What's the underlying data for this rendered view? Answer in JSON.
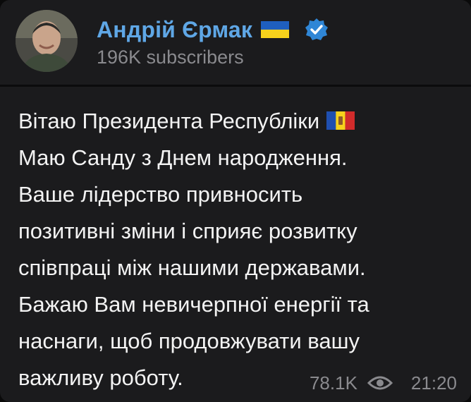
{
  "channel": {
    "name": "Андрій Єрмак",
    "subscribers": "196K subscribers",
    "flag_icon": "ukraine-flag-icon",
    "verified_icon": "verified-badge-icon"
  },
  "post": {
    "lines": [
      "Вітаю Президента Республіки",
      "Маю Санду з Днем народження.",
      "Ваше лідерство привносить",
      "позитивні зміни і сприяє розвитку",
      "співпраці між нашими державами.",
      "Бажаю Вам невичерпної енергії та",
      "наснаги, щоб продовжувати вашу",
      "важливу роботу."
    ],
    "inline_flag_icon": "moldova-flag-icon",
    "views": "78.1K",
    "views_icon": "eye-icon",
    "time": "21:20"
  },
  "colors": {
    "background": "#1b1b1d",
    "name": "#5fa7e6",
    "text": "#f3f3f3",
    "muted": "#8a8a8e",
    "ua_blue": "#1f5fbf",
    "ua_yellow": "#f7d21c",
    "verified": "#2f86d6"
  }
}
